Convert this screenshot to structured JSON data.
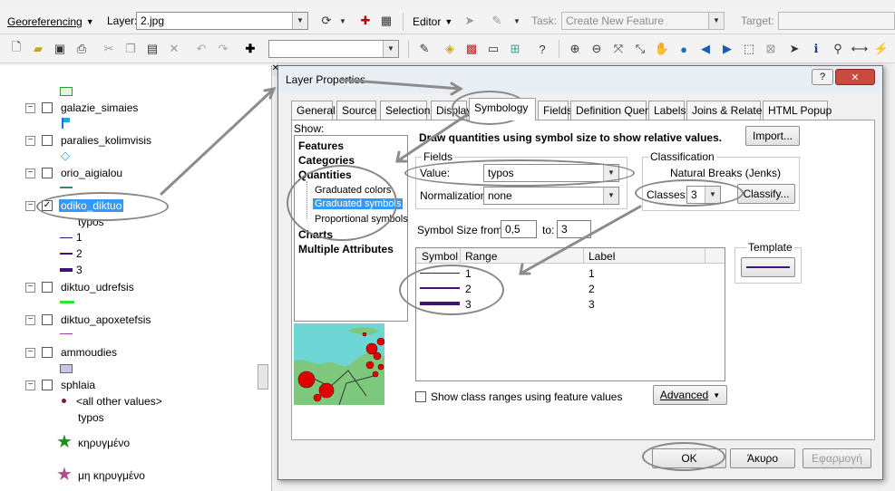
{
  "toolbar1": {
    "georef_label": "Georeferencing",
    "layer_label": "Layer:",
    "layer_value": "2.jpg",
    "editor_label": "Editor",
    "task_label": "Task:",
    "task_value": "Create New Feature",
    "target_label": "Target:"
  },
  "toc": {
    "layers": [
      {
        "name": "galazie_simaies"
      },
      {
        "name": "paralies_kolimvisis"
      },
      {
        "name": "orio_aigialou"
      },
      {
        "name": "odiko_diktuo",
        "field": "typos",
        "classes": [
          "1",
          "2",
          "3"
        ]
      },
      {
        "name": "diktuo_udrefsis"
      },
      {
        "name": "diktuo_apoxetefsis"
      },
      {
        "name": "ammoudies"
      },
      {
        "name": "sphlaia",
        "all_other": "<all other values>",
        "field": "typos",
        "values": [
          "κηρυγμένο",
          "μη κηρυγμένο"
        ]
      }
    ]
  },
  "dialog": {
    "title": "Layer Properties",
    "help": "?",
    "close": "✕",
    "tabs": [
      "General",
      "Source",
      "Selection",
      "Display",
      "Symbology",
      "Fields",
      "Definition Query",
      "Labels",
      "Joins & Relates",
      "HTML Popup"
    ],
    "show_label": "Show:",
    "show_items": [
      {
        "label": "Features",
        "bold": true
      },
      {
        "label": "Categories",
        "bold": true
      },
      {
        "label": "Quantities",
        "bold": true
      },
      {
        "label": "Graduated colors",
        "bold": false
      },
      {
        "label": "Graduated symbols",
        "bold": false
      },
      {
        "label": "Proportional symbols",
        "bold": false
      },
      {
        "label": "Charts",
        "bold": true
      },
      {
        "label": "Multiple Attributes",
        "bold": true
      }
    ],
    "description": "Draw quantities using symbol size to show relative values.",
    "import": "Import...",
    "fields_group": "Fields",
    "value_label": "Value:",
    "value": "typos",
    "normalization_label": "Normalization:",
    "normalization": "none",
    "classification_group": "Classification",
    "method": "Natural Breaks (Jenks)",
    "classes_label": "Classes:",
    "classes_value": "3",
    "classify": "Classify...",
    "size_from_label": "Symbol Size from:",
    "size_from": "0,5",
    "size_to_label": "to:",
    "size_to": "3",
    "template_group": "Template",
    "table_headers": [
      "Symbol",
      "Range",
      "Label"
    ],
    "rows": [
      {
        "range": "1",
        "label": "1"
      },
      {
        "range": "2",
        "label": "2"
      },
      {
        "range": "3",
        "label": "3"
      }
    ],
    "show_ranges": "Show class ranges using feature values",
    "advanced": "Advanced",
    "ok": "OK",
    "cancel": "Άκυρο",
    "apply": "Εφαρμογή"
  },
  "colors": {
    "line_purple": "#3d1478",
    "selection_blue": "#3399ff",
    "close_red": "#c94a3e",
    "sea_cyan": "#6fd6d6",
    "land_green": "#7ec87e",
    "point_red": "#e00000"
  }
}
